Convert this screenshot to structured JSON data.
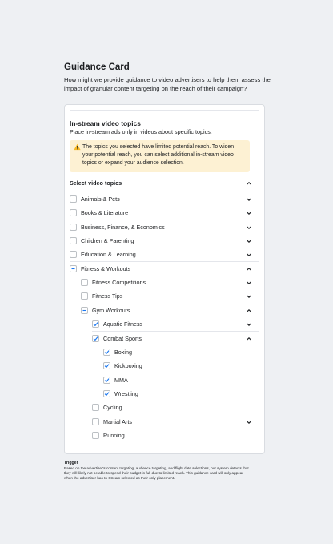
{
  "page": {
    "title": "Guidance Card",
    "subtitle": "How might we provide guidance to video advertisers to help them assess the impact of granular content targeting on the reach of their campaign?"
  },
  "card": {
    "section_title": "In-stream video topics",
    "section_desc": "Place in-stream ads only in videos about specific topics.",
    "warning": {
      "icon": "warning-icon",
      "text": "The topics you selected have limited potential reach. To widen your potential reach, you can select additional in-stream video topics or expand your audience selection."
    },
    "select_title": "Select video topics",
    "topics": [
      {
        "label": "Animals & Pets",
        "state": "unchecked",
        "chevron": "down"
      },
      {
        "label": "Books & Literature",
        "state": "unchecked",
        "chevron": "down"
      },
      {
        "label": "Business, Finance, & Economics",
        "state": "unchecked",
        "chevron": "down"
      },
      {
        "label": "Children & Parenting",
        "state": "unchecked",
        "chevron": "down"
      },
      {
        "label": "Education & Learning",
        "state": "unchecked",
        "chevron": "down"
      },
      {
        "label": "Fitness & Workouts",
        "state": "indeterminate",
        "chevron": "up"
      },
      {
        "label": "Fitness Competitions",
        "state": "unchecked",
        "chevron": "down"
      },
      {
        "label": "Fitness Tips",
        "state": "unchecked",
        "chevron": "down"
      },
      {
        "label": "Gym Workouts",
        "state": "indeterminate",
        "chevron": "up"
      },
      {
        "label": "Aquatic Fitness",
        "state": "checked",
        "chevron": "down"
      },
      {
        "label": "Combat Sports",
        "state": "checked",
        "chevron": "up"
      },
      {
        "label": "Boxing",
        "state": "checked",
        "chevron": "none"
      },
      {
        "label": "Kickboxing",
        "state": "checked",
        "chevron": "none"
      },
      {
        "label": "MMA",
        "state": "checked",
        "chevron": "none"
      },
      {
        "label": "Wrestling",
        "state": "checked",
        "chevron": "none"
      },
      {
        "label": "Cycling",
        "state": "unchecked",
        "chevron": "none"
      },
      {
        "label": "Martial Arts",
        "state": "unchecked",
        "chevron": "down"
      },
      {
        "label": "Running",
        "state": "unchecked",
        "chevron": "none"
      }
    ]
  },
  "footer": {
    "title": "Trigger",
    "text": "Based on the advertiser's content targeting, audience targeting, and flight date selections, our system detects that they will likely not be able to spend their budget in full due to limited reach. This guidance card will only appear when the advertiser has In-Stream selected as their only placement."
  },
  "colors": {
    "accent": "#1877f2",
    "warning_bg": "#fdf1d3",
    "warning_icon": "#f7b928",
    "background": "#eef0f3"
  }
}
